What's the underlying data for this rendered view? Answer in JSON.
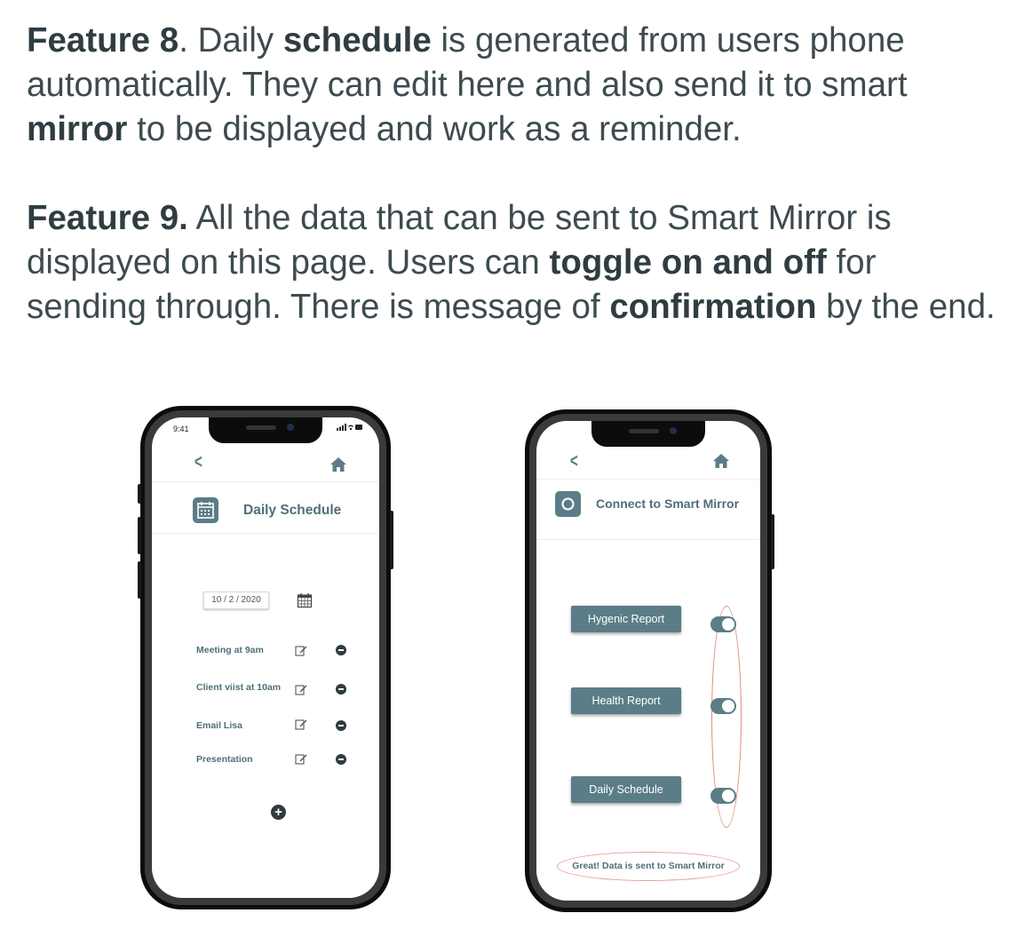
{
  "feature8": {
    "lead": "Feature 8",
    "t1": ". Daily ",
    "b1": "schedule",
    "t2": " is generated from users phone automatically. They can edit here and also send it to smart ",
    "b2": "mirror",
    "t3": " to be displayed and work as a reminder."
  },
  "feature9": {
    "lead": "Feature 9.",
    "t1": " All the data that can be sent to Smart Mirror is displayed on this page. Users can ",
    "b1": "toggle on and off",
    "t2": " for sending through. There is message of ",
    "b2": "confirmation",
    "t3": " by the end."
  },
  "phone1": {
    "status_time": "9:41",
    "status_icons": "signal-wifi-battery",
    "back_label": "<",
    "title": "Daily Schedule",
    "date_value": "10 / 2 / 2020",
    "items": [
      {
        "label": "Meeting at 9am"
      },
      {
        "label": "Client viist at 10am"
      },
      {
        "label": "Email Lisa"
      },
      {
        "label": "Presentation"
      }
    ],
    "icons": {
      "back": "chevron-left-icon",
      "home": "home-icon",
      "title": "calendar-icon",
      "edit": "edit-icon",
      "remove": "minus-circle-icon",
      "add": "plus-circle-icon"
    }
  },
  "phone2": {
    "back_label": "<",
    "title": "Connect to Smart Mirror",
    "buttons": [
      {
        "label": "Hygenic Report",
        "toggle_on": true
      },
      {
        "label": "Health Report",
        "toggle_on": true
      },
      {
        "label": "Daily Schedule",
        "toggle_on": true
      }
    ],
    "confirmation": "Great! Data is sent to Smart Mirror",
    "icons": {
      "back": "chevron-left-icon",
      "home": "home-icon",
      "title": "mirror-icon"
    }
  },
  "colors": {
    "accent": "#5b7d87",
    "text": "#3d4b50",
    "highlight_outline": "#e28a7c"
  }
}
